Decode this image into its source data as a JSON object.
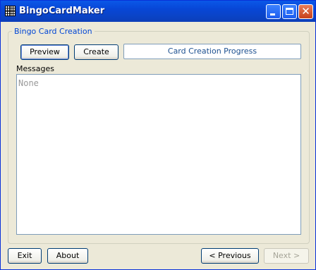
{
  "window": {
    "title": "BingoCardMaker"
  },
  "titlebar_buttons": {
    "minimize_icon": "minimize-icon",
    "maximize_icon": "maximize-icon",
    "close_icon": "close-icon"
  },
  "group": {
    "label": "Bingo Card Creation",
    "preview_label": "Preview",
    "create_label": "Create",
    "progress_text": "Card Creation Progress",
    "messages_label": "Messages",
    "messages_text": "None"
  },
  "footer": {
    "exit_label": "Exit",
    "about_label": "About",
    "previous_label": "< Previous",
    "next_label": "Next >"
  },
  "colors": {
    "title_bar": "#0a58e8",
    "group_label": "#0046d5",
    "window_bg": "#ece9d8"
  }
}
